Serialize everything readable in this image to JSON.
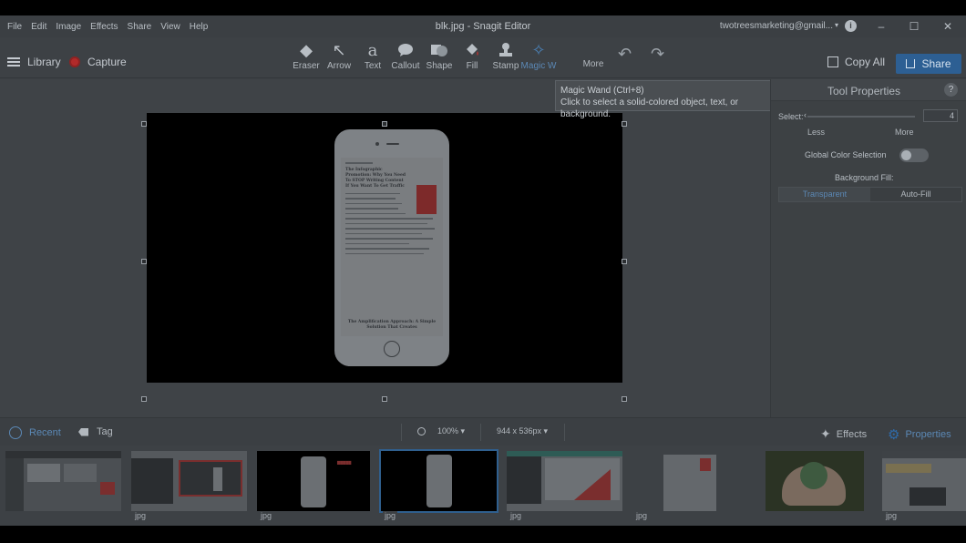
{
  "window": {
    "title": "blk.jpg - Snagit Editor",
    "menu": [
      "File",
      "Edit",
      "Image",
      "Effects",
      "Share",
      "View",
      "Help"
    ],
    "account": "twotreesmarketing@gmail...",
    "controls": [
      "minimize",
      "maximize",
      "close"
    ]
  },
  "toolbar": {
    "library_label": "Library",
    "capture_label": "Capture",
    "tools": [
      {
        "label": "Eraser",
        "icon": "eraser-icon"
      },
      {
        "label": "Arrow",
        "icon": "arrow-icon"
      },
      {
        "label": "Text",
        "icon": "text-icon"
      },
      {
        "label": "Callout",
        "icon": "callout-icon"
      },
      {
        "label": "Shape",
        "icon": "shape-icon"
      },
      {
        "label": "Fill",
        "icon": "fill-icon"
      },
      {
        "label": "Stamp",
        "icon": "stamp-icon"
      },
      {
        "label": "Magic W",
        "icon": "magic-wand-icon",
        "active": true
      }
    ],
    "more_label": "More",
    "copy_all_label": "Copy All",
    "share_label": "Share"
  },
  "tooltip": {
    "title": "Magic Wand (Ctrl+8)",
    "text": "Click to select a solid-colored object, text, or background."
  },
  "canvas": {
    "doc_title": "The Infographic Promotion: Why You Need To STOP Writing Content If You Want To Get Traffic",
    "doc_subtitle": "The Amplification Approach: A Simple Solution That Creates"
  },
  "tool_properties": {
    "title": "Tool Properties",
    "help": "?",
    "select_label": "Select:",
    "select_value": "4",
    "less_label": "Less",
    "more_label": "More",
    "global_color_label": "Global Color Selection",
    "global_color_on": false,
    "bg_fill_label": "Background Fill:",
    "bg_fill_options": [
      "Transparent",
      "Auto-Fill"
    ],
    "bg_fill_selected": "Transparent"
  },
  "bottom_bar": {
    "recent_label": "Recent",
    "tag_label": "Tag",
    "zoom": "100% ▾",
    "dimensions": "944 x 536px ▾",
    "effects_label": "Effects",
    "properties_label": "Properties"
  },
  "tray": {
    "thumbnails": [
      {
        "label": "",
        "kind": "screenshot"
      },
      {
        "label": "jpg",
        "kind": "slides"
      },
      {
        "label": "jpg",
        "kind": "phone-text"
      },
      {
        "label": "jpg",
        "kind": "phone",
        "selected": true
      },
      {
        "label": "jpg",
        "kind": "web"
      },
      {
        "label": "jpg",
        "kind": "document"
      },
      {
        "label": "",
        "kind": "hands"
      },
      {
        "label": "jpg",
        "kind": "web2"
      }
    ]
  },
  "colors": {
    "accent": "#2d5f93",
    "active_tool": "#5b88b5",
    "record": "#b12a2a"
  }
}
